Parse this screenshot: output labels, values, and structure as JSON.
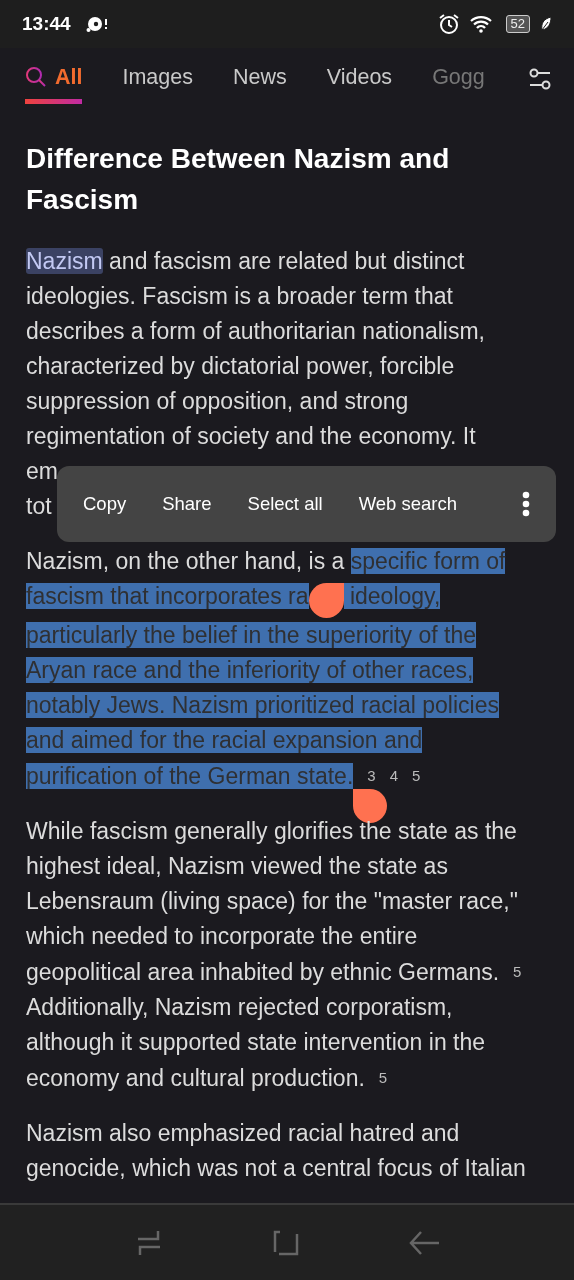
{
  "status_bar": {
    "time": "13:44",
    "battery": "52"
  },
  "tabs": [
    {
      "label": "All",
      "selected": true,
      "kind": "search"
    },
    {
      "label": "Images",
      "selected": false,
      "kind": "plain"
    },
    {
      "label": "News",
      "selected": false,
      "kind": "plain"
    },
    {
      "label": "Videos",
      "selected": false,
      "kind": "plain"
    },
    {
      "label": "Gogg",
      "selected": false,
      "kind": "faded"
    }
  ],
  "article": {
    "title": "Difference Between Nazism and Fascism",
    "paragraphs": [
      {
        "segments": [
          {
            "kind": "highlight",
            "text": "Nazism"
          },
          {
            "kind": "text",
            "text": " and fascism are related but distinct ideologies. Fascism is a broader term that describes a form of authoritarian nationalism, characterized by dictatorial power, forcible suppression of opposition, and strong regimentation of society and the economy. It"
          }
        ],
        "covered_lines": [
          "em",
          "tot"
        ]
      },
      {
        "segments": [
          {
            "kind": "text",
            "text": "Nazism, on the other hand, is a "
          },
          {
            "kind": "selected",
            "text": "specific form of"
          },
          {
            "kind": "break"
          },
          {
            "kind": "selected",
            "text": "fascism that incorporates ra"
          },
          {
            "kind": "handle_start"
          },
          {
            "kind": "selected",
            "text": " ideology,"
          },
          {
            "kind": "break"
          },
          {
            "kind": "selected",
            "text": "particularly the belief in the superiority of the"
          },
          {
            "kind": "break"
          },
          {
            "kind": "selected",
            "text": "Aryan race and the inferiority of other races,"
          },
          {
            "kind": "break"
          },
          {
            "kind": "selected",
            "text": "notably Jews. Nazism prioritized racial policies"
          },
          {
            "kind": "break"
          },
          {
            "kind": "selected",
            "text": "and aimed for the racial expansion and"
          },
          {
            "kind": "break"
          },
          {
            "kind": "selected",
            "text": "purification of the German state."
          },
          {
            "kind": "handle_end"
          },
          {
            "kind": "cite",
            "text": "3"
          },
          {
            "kind": "cite",
            "text": "4"
          },
          {
            "kind": "cite",
            "text": "5"
          }
        ]
      },
      {
        "segments": [
          {
            "kind": "text",
            "text": "While fascism generally glorifies the state as the highest ideal, Nazism viewed the state as Lebensraum (living space) for the \"master race,\" which needed to incorporate the entire geopolitical area inhabited by ethnic Germans."
          },
          {
            "kind": "cite",
            "text": "5"
          },
          {
            "kind": "text",
            "text": " Additionally, Nazism rejected corporatism, although it supported state intervention in the economy and cultural production."
          },
          {
            "kind": "cite",
            "text": "5"
          }
        ]
      },
      {
        "segments": [
          {
            "kind": "text",
            "text": "Nazism also emphasized racial hatred and genocide, which was not a central focus of Italian"
          }
        ]
      }
    ]
  },
  "context_menu": {
    "items": [
      "Copy",
      "Share",
      "Select all",
      "Web search"
    ]
  }
}
